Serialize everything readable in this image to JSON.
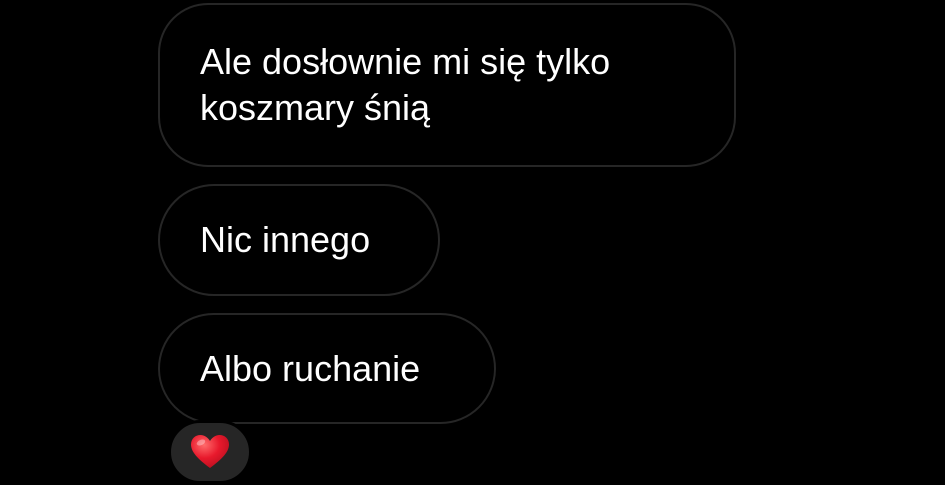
{
  "messages": [
    {
      "text": "Ale dosłownie mi się tylko\nkoszmary śnią"
    },
    {
      "text": "Nic innego"
    },
    {
      "text": "Albo ruchanie"
    }
  ],
  "reaction": {
    "icon": "red-heart-icon",
    "color": "#e8192c"
  },
  "colors": {
    "background": "#000000",
    "bubble_border": "#262626",
    "text": "#ffffff",
    "reaction_background": "#262626"
  }
}
